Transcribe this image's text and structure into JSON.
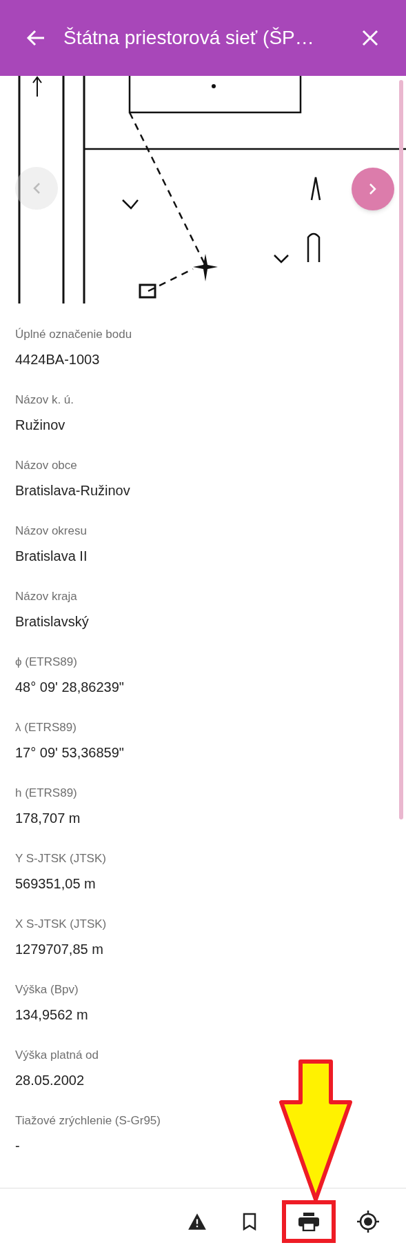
{
  "header": {
    "title": "Štátna priestorová sieť (ŠP…"
  },
  "fields": [
    {
      "label": "Úplné označenie bodu",
      "value": "4424BA-1003"
    },
    {
      "label": "Názov k. ú.",
      "value": "Ružinov"
    },
    {
      "label": "Názov obce",
      "value": "Bratislava-Ružinov"
    },
    {
      "label": "Názov okresu",
      "value": "Bratislava II"
    },
    {
      "label": "Názov kraja",
      "value": "Bratislavský"
    },
    {
      "label": "ϕ (ETRS89)",
      "value": "48° 09' 28,86239\""
    },
    {
      "label": "λ (ETRS89)",
      "value": "17° 09' 53,36859\""
    },
    {
      "label": "h (ETRS89)",
      "value": "178,707 m"
    },
    {
      "label": "Y S-JTSK (JTSK)",
      "value": "569351,05 m"
    },
    {
      "label": "X S-JTSK (JTSK)",
      "value": "1279707,85 m"
    },
    {
      "label": "Výška (Bpv)",
      "value": "134,9562 m"
    },
    {
      "label": "Výška platná od",
      "value": "28.05.2002"
    },
    {
      "label": "Tiažové zrýchlenie (S-Gr95)",
      "value": "-"
    }
  ],
  "toolbar": [
    {
      "kind": "warning",
      "selected": false
    },
    {
      "kind": "bookmark",
      "selected": false
    },
    {
      "kind": "print",
      "selected": true
    },
    {
      "kind": "locate",
      "selected": false
    }
  ]
}
